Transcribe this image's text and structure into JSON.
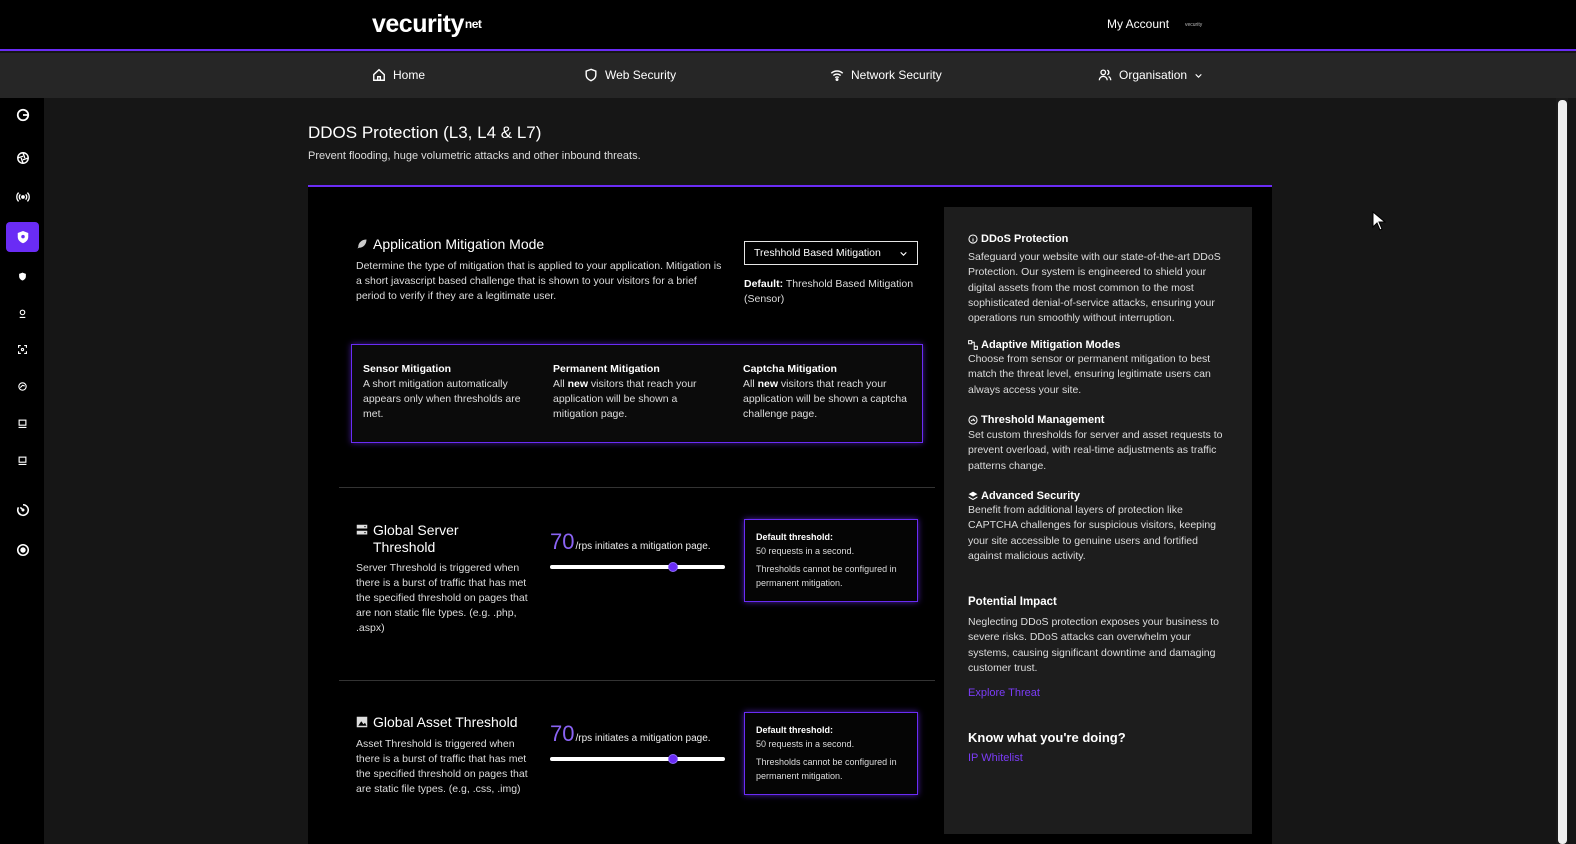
{
  "header": {
    "logo_text": "vecurity",
    "logo_suffix": "net",
    "account_label": "My Account",
    "account_mini": "vecurity"
  },
  "nav": {
    "items": [
      {
        "label": "Home",
        "icon": "home-icon"
      },
      {
        "label": "Web Security",
        "icon": "shield-icon"
      },
      {
        "label": "Network Security",
        "icon": "wifi-icon"
      },
      {
        "label": "Organisation",
        "icon": "users-icon"
      }
    ]
  },
  "sidebar": {
    "items": [
      {
        "icon": "dashboard-icon",
        "active": false
      },
      {
        "icon": "aperture-icon",
        "active": false
      },
      {
        "icon": "broadcast-icon",
        "active": false
      },
      {
        "icon": "shield-icon",
        "active": true
      },
      {
        "icon": "shield-small-icon",
        "active": false
      },
      {
        "icon": "pin-icon",
        "active": false
      },
      {
        "icon": "scan-icon",
        "active": false
      },
      {
        "icon": "globe-icon",
        "active": false
      },
      {
        "icon": "server-icon",
        "active": false
      },
      {
        "icon": "server-icon",
        "active": false
      },
      {
        "icon": "timer-icon",
        "active": false
      },
      {
        "icon": "target-icon",
        "active": false
      }
    ]
  },
  "page": {
    "title": "DDOS Protection (L3, L4 & L7)",
    "subtitle": "Prevent flooding, huge volumetric attacks and other inbound threats."
  },
  "mitigation_mode": {
    "title": "Application Mitigation Mode",
    "description": "Determine the type of mitigation that is applied to your application. Mitigation is a short javascript based challenge that is shown to your visitors for a brief period to verify if they are a legitimate user.",
    "selected": "Treshhold Based Mitigation",
    "default_label": "Default:",
    "default_value": "Threshold Based Mitigation (Sensor)"
  },
  "modes": [
    {
      "title": "Sensor Mitigation",
      "text": "A short mitigation automatically appears only when thresholds are met."
    },
    {
      "title": "Permanent Mitigation",
      "pre": "All ",
      "bold": "new",
      "post": " visitors that reach your application will be shown a mitigation page."
    },
    {
      "title": "Captcha Mitigation",
      "pre": "All ",
      "bold": "new",
      "post": " visitors that reach your application will be shown a captcha challenge page."
    }
  ],
  "server_threshold": {
    "title": "Global Server Threshold",
    "description": "Server Threshold is triggered when there is a burst of traffic that has met the specified threshold on pages that are non static file types. (e.g. .php, .aspx)",
    "value": "70",
    "unit_text": "/rps initiates a mitigation page.",
    "slider_fraction": 0.7,
    "box_title": "Default threshold:",
    "box_value": "50 requests in a second.",
    "box_note": "Thresholds cannot be configured in permanent mitigation."
  },
  "asset_threshold": {
    "title": "Global Asset Threshold",
    "description": "Asset Threshold is triggered when there is a burst of traffic that has met the specified threshold on pages that are static file types. (e.g, .css, .img)",
    "value": "70",
    "unit_text": "/rps initiates a mitigation page.",
    "slider_fraction": 0.7,
    "box_title": "Default threshold:",
    "box_value": "50 requests in a second.",
    "box_note": "Thresholds cannot be configured in permanent mitigation."
  },
  "info": {
    "sections": [
      {
        "title": "DDoS Protection",
        "icon": "info-icon",
        "text": "Safeguard your website with our state-of-the-art DDoS Protection. Our system is engineered to shield your digital assets from the most common to the most sophisticated denial-of-service attacks, ensuring your operations run smoothly without interruption."
      },
      {
        "title": "Adaptive Mitigation Modes",
        "icon": "nodes-icon",
        "text": "Choose from sensor or permanent mitigation to best match the threat level, ensuring legitimate users can always access your site."
      },
      {
        "title": "Threshold Management",
        "icon": "gauge-icon",
        "text": "Set custom thresholds for server and asset requests to prevent overload, with real-time adjustments as traffic patterns change."
      },
      {
        "title": "Advanced Security",
        "icon": "layers-icon",
        "text": "Benefit from additional layers of protection like CAPTCHA challenges for suspicious visitors, keeping your site accessible to genuine users and fortified against malicious activity."
      }
    ],
    "impact_title": "Potential Impact",
    "impact_text": "Neglecting DDoS protection exposes your business to severe risks. DDoS attacks can overwhelm your systems, causing significant downtime and damaging customer trust.",
    "explore_link": "Explore Threat",
    "know_title": "Know what you're doing?",
    "whitelist_link": "IP Whitelist"
  },
  "colors": {
    "accent": "#6a2cf5",
    "value_purple": "#8a63f3",
    "link": "#7b3cf7"
  }
}
